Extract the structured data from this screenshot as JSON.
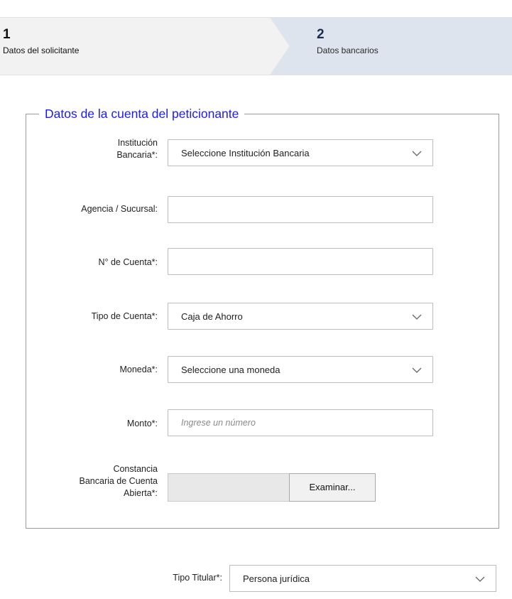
{
  "steps": [
    {
      "number": "1",
      "label": "Datos del solicitante"
    },
    {
      "number": "2",
      "label": "Datos bancarios"
    }
  ],
  "section": {
    "legend": "Datos de la cuenta del peticionante"
  },
  "fields": {
    "institucion": {
      "label_line1": "Institución",
      "label_line2": "Bancaria*:",
      "value": "Seleccione Institución Bancaria",
      "icon": "chevron-down-icon"
    },
    "agencia": {
      "label": "Agencia / Sucursal:",
      "value": ""
    },
    "cuenta": {
      "label": "N° de Cuenta*:",
      "value": ""
    },
    "tipo_cuenta": {
      "label": "Tipo de Cuenta*:",
      "value": "Caja de Ahorro",
      "icon": "chevron-down-icon"
    },
    "moneda": {
      "label": "Moneda*:",
      "value": "Seleccione una moneda",
      "icon": "chevron-down-icon"
    },
    "monto": {
      "label": "Monto*:",
      "placeholder": "Ingrese un número"
    },
    "constancia": {
      "label_line1": "Constancia",
      "label_line2": "Bancaria de Cuenta",
      "label_line3": "Abierta*:",
      "button_label": "Examinar..."
    }
  },
  "tipo_titular": {
    "label": "Tipo Titular*:",
    "value": "Persona jurídica",
    "icon": "chevron-down-icon"
  },
  "colors": {
    "stepper_active": "#dde4ee",
    "stepper_inactive": "#f2f2f2",
    "legend_blue": "#1c1cf0",
    "border": "#bdbdbd"
  }
}
